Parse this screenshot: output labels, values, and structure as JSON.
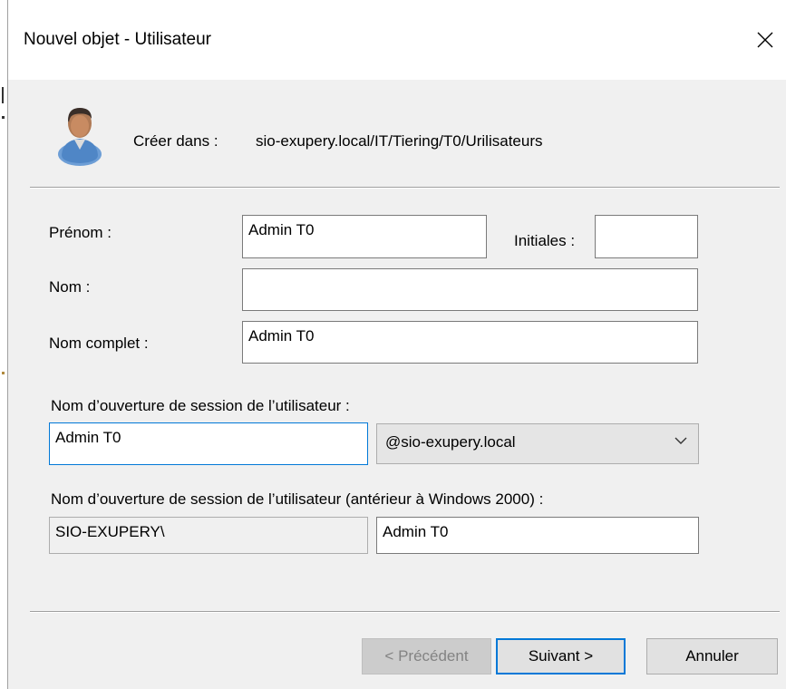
{
  "window": {
    "title": "Nouvel objet - Utilisateur",
    "close_icon": "close-icon"
  },
  "header": {
    "create_in_label": "Créer dans :",
    "create_in_path": "sio-exupery.local/IT/Tiering/T0/Urilisateurs",
    "icon": "user-icon"
  },
  "form": {
    "first_name_label": "Prénom :",
    "first_name_value": "Admin T0",
    "initials_label": "Initiales :",
    "initials_value": "",
    "last_name_label": "Nom :",
    "last_name_value": "",
    "full_name_label": "Nom complet :",
    "full_name_value": "Admin T0",
    "logon_label": "Nom d’ouverture de session de l’utilisateur :",
    "logon_value": "Admin T0",
    "domain_suffix": "@sio-exupery.local",
    "pre2000_label": "Nom d’ouverture de session de l’utilisateur (antérieur à Windows 2000) :",
    "pre2000_domain": "SIO-EXUPERY\\",
    "pre2000_value": "Admin T0"
  },
  "buttons": {
    "previous": "< Précédent",
    "next": "Suivant >",
    "cancel": "Annuler"
  }
}
